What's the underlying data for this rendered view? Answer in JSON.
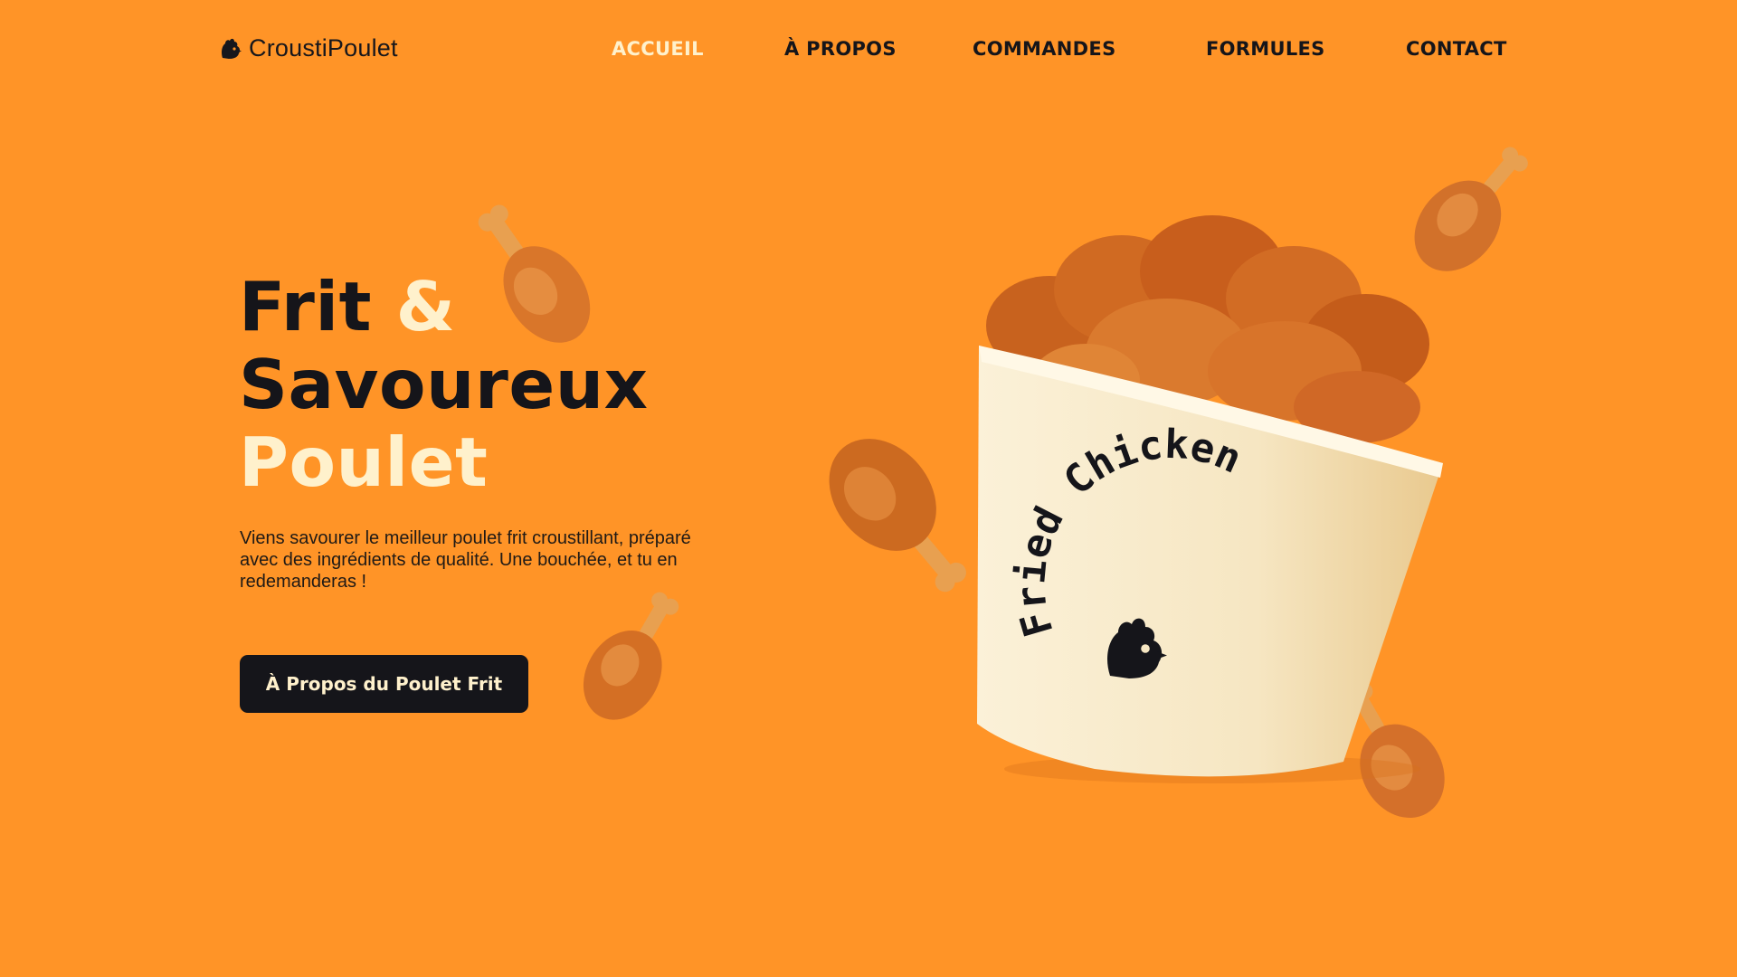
{
  "header": {
    "brand": "CroustiPoulet",
    "logo_icon": "chicken-head-icon",
    "nav": [
      {
        "label": "ACCUEIL",
        "active": true
      },
      {
        "label": "À PROPOS",
        "active": false
      },
      {
        "label": "COMMANDES",
        "active": false
      },
      {
        "label": "FORMULES",
        "active": false
      },
      {
        "label": "CONTACT",
        "active": false
      }
    ]
  },
  "hero": {
    "headline": {
      "word1": "Frit",
      "amp": "&",
      "word2": "Savoureux",
      "word3": "Poulet"
    },
    "description": "Viens savourer le meilleur poulet frit croustillant, préparé avec des ingrédients de qualité. Une bouchée, et tu en redemanderas !",
    "cta_label": "À Propos du Poulet Frit"
  },
  "artwork": {
    "bucket_text": "Fried Chicken",
    "bucket_icon": "chicken-head-icon"
  },
  "colors": {
    "background": "#FF9427",
    "accent_cream": "#FFF1CC",
    "dark": "#15151A"
  }
}
